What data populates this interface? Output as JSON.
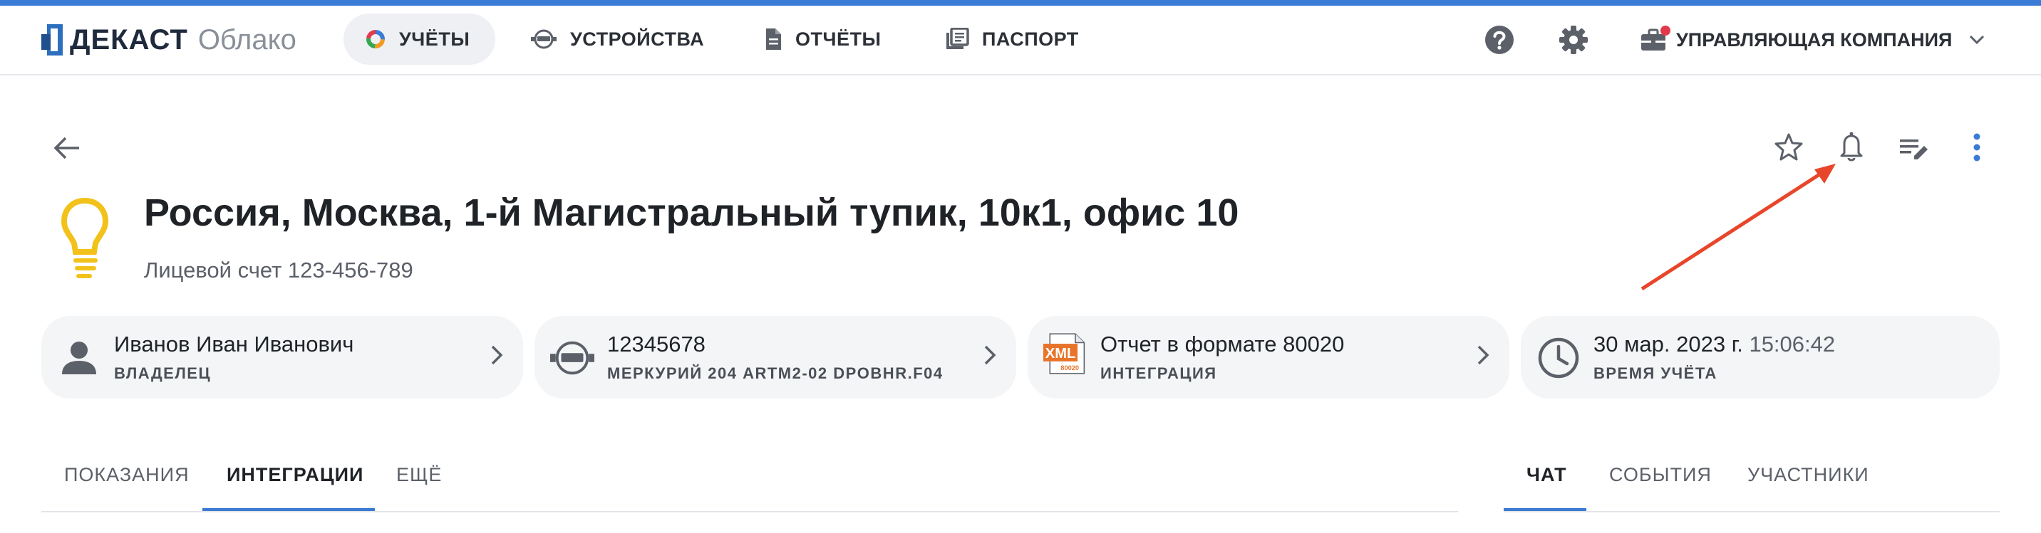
{
  "brand": {
    "logo_text": "ДЕКАСТ",
    "logo_sub": "Облако"
  },
  "nav": {
    "items": [
      {
        "label": "УЧЁТЫ",
        "icon": "donut-chart-icon",
        "active": true
      },
      {
        "label": "УСТРОЙСТВА",
        "icon": "meter-icon",
        "active": false
      },
      {
        "label": "ОТЧЁТЫ",
        "icon": "document-icon",
        "active": false
      },
      {
        "label": "ПАСПОРТ",
        "icon": "library-books-icon",
        "active": false
      }
    ],
    "help_icon": "help-circle-icon",
    "settings_icon": "gear-icon",
    "company": {
      "label": "УПРАВЛЯЮЩАЯ КОМПАНИЯ",
      "icon": "briefcase-icon"
    }
  },
  "toolbar": {
    "icons": [
      "back-arrow-icon",
      "star-outline-icon",
      "bell-icon",
      "edit-list-icon",
      "more-vert-icon"
    ]
  },
  "header": {
    "title": "Россия, Москва, 1-й Магистральный тупик, 10к1, офис 10",
    "subtitle": "Лицевой счет 123-456-789",
    "icon": "lightbulb-icon"
  },
  "cards": [
    {
      "primary": "Иванов Иван Иванович",
      "secondary": "ВЛАДЕЛЕЦ",
      "icon": "person-icon"
    },
    {
      "primary": "12345678",
      "secondary": "МЕРКУРИЙ 204 ARTM2-02 DPOBHR.F04",
      "icon": "meter-icon"
    },
    {
      "primary": "Отчет в формате 80020",
      "secondary": "ИНТЕГРАЦИЯ",
      "icon": "xml-file-icon",
      "icon_text": "XML",
      "icon_subtext": "80020"
    },
    {
      "primary_date": "30 мар. 2023 г.",
      "primary_time": "15:06:42",
      "secondary": "ВРЕМЯ УЧЁТА",
      "icon": "clock-icon"
    }
  ],
  "tabs_left": [
    {
      "label": "ПОКАЗАНИЯ",
      "active": false
    },
    {
      "label": "ИНТЕГРАЦИИ",
      "active": true
    },
    {
      "label": "ЕЩЁ",
      "active": false
    }
  ],
  "tabs_right": [
    {
      "label": "ЧАТ",
      "active": true
    },
    {
      "label": "СОБЫТИЯ",
      "active": false
    },
    {
      "label": "УЧАСТНИКИ",
      "active": false
    }
  ],
  "colors": {
    "accent": "#3a7bd5",
    "annotation_arrow": "#e8462a",
    "bulb": "#f2c21b",
    "xml_badge": "#e8742a"
  }
}
